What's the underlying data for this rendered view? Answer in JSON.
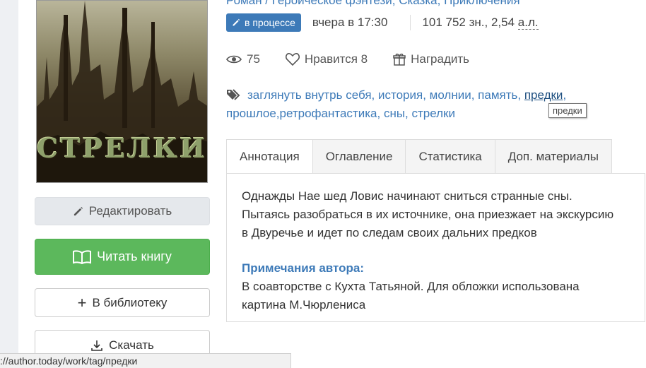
{
  "book": {
    "cover_title": "СТРЕЛКИ",
    "genres": "Роман / Героическое фэнтези, Сказка, Приключения",
    "status_badge": "в процессе",
    "updated": "вчера в 17:30",
    "size_prefix": "101 752 зн., 2,54 ",
    "size_unit": "а.л.",
    "views": "75",
    "likes_label": "Нравится 8",
    "reward_label": "Наградить"
  },
  "tags": [
    {
      "label": "заглянуть внутрь себя",
      "sep": ", "
    },
    {
      "label": "история",
      "sep": ", "
    },
    {
      "label": "молнии",
      "sep": ", "
    },
    {
      "label": "память",
      "sep": ", "
    },
    {
      "label": "предки",
      "sep": ", "
    },
    {
      "label": "прошлое",
      "sep": ","
    },
    {
      "label": "ретрофантастика",
      "sep": ", "
    },
    {
      "label": "сны",
      "sep": ", "
    },
    {
      "label": "стрелки",
      "sep": ""
    }
  ],
  "tooltip": "предки",
  "buttons": {
    "edit": "Редактировать",
    "read": "Читать книгу",
    "library": "В библиотеку",
    "download": "Скачать"
  },
  "tabs": [
    "Аннотация",
    "Оглавление",
    "Статистика",
    "Доп. материалы"
  ],
  "annotation": {
    "lines": [
      "Однажды Нае шед Ловис начинают сниться странные сны.",
      "Пытаясь разобраться в их источнике, она приезжает на экскурсию",
      "в Двуречье и идет по следам своих дальних предков"
    ],
    "notes_title": "Примечания автора:",
    "notes_lines": [
      "В соавторстве с Кухта Татьяной. Для обложки использована",
      "картина М.Чюрлениса"
    ]
  },
  "status_url": "://author.today/work/tag/предки",
  "colors": {
    "accent": "#3d7ab8",
    "read_button": "#5cb85c"
  }
}
